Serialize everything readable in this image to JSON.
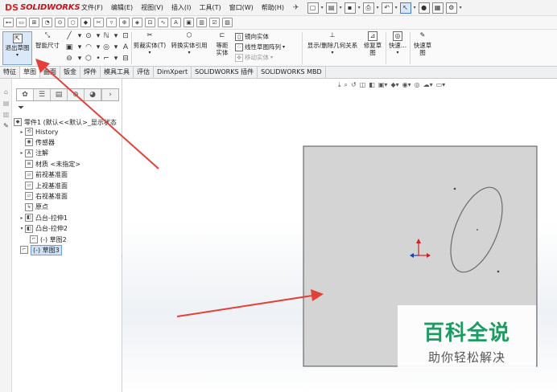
{
  "app": {
    "logo_mark": "DS",
    "brand": "SOLIDWORKS",
    "menus": [
      "文件(F)",
      "编辑(E)",
      "视图(V)",
      "插入(I)",
      "工具(T)",
      "窗口(W)",
      "帮助(H)"
    ]
  },
  "command_manager": {
    "exit_sketch": "退出草图",
    "smart_dimension": "智能尺寸",
    "trim_entities": "剪裁实体(T)",
    "convert_entities": "转换实体引用",
    "offset_entities": "等距实体",
    "mirror_entities": "镜向实体",
    "linear_pattern": "线性草图阵列",
    "move_entities": "移动实体",
    "display_delete_relations": "显示/删除几何关系",
    "repair_sketch": "修复草图",
    "quick_snaps": "快速...",
    "rapid_sketch": "快速草图"
  },
  "tabs": [
    "特征",
    "草图",
    "曲面",
    "钣金",
    "焊件",
    "模具工具",
    "评估",
    "DimXpert",
    "SOLIDWORKS 插件",
    "SOLIDWORKS MBD"
  ],
  "active_tab_index": 1,
  "tree": {
    "root": "零件1 (默认<<默认>_显示状态",
    "items": [
      {
        "label": "History",
        "icon": "history-icon",
        "expander": "▸"
      },
      {
        "label": "传感器",
        "icon": "sensor-icon",
        "expander": ""
      },
      {
        "label": "注解",
        "icon": "annotation-icon",
        "expander": "▸"
      },
      {
        "label": "材质 <未指定>",
        "icon": "material-icon",
        "expander": ""
      },
      {
        "label": "前视基准面",
        "icon": "plane-icon",
        "expander": ""
      },
      {
        "label": "上视基准面",
        "icon": "plane-icon",
        "expander": ""
      },
      {
        "label": "右视基准面",
        "icon": "plane-icon",
        "expander": ""
      },
      {
        "label": "原点",
        "icon": "origin-icon",
        "expander": ""
      },
      {
        "label": "凸台-拉伸1",
        "icon": "extrude-icon",
        "expander": "▸"
      },
      {
        "label": "凸台-拉伸2",
        "icon": "extrude-icon",
        "expander": "▾"
      },
      {
        "label": "(-) 草图2",
        "icon": "sketch-icon",
        "expander": ""
      },
      {
        "label": "(-) 草图3",
        "icon": "sketch-icon",
        "expander": ""
      }
    ],
    "selected_index": 11
  },
  "watermark": {
    "title": "百科全说",
    "subtitle": "助你轻松解决"
  },
  "colors": {
    "face_fill": "#d4d4d4",
    "face_edge": "#555555",
    "annotation_arrow": "#e3403a",
    "watermark_green": "#1d9c62",
    "axis_x": "#d12020",
    "axis_y": "#1040c8"
  }
}
